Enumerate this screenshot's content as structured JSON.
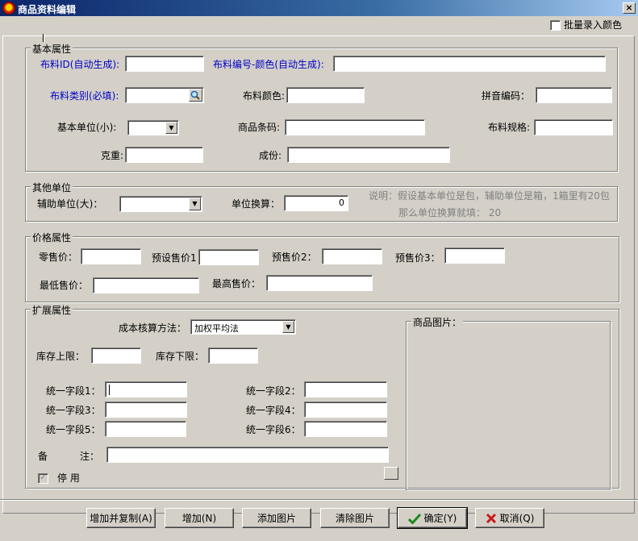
{
  "window": {
    "title": "商品资料编辑",
    "close_label": "×"
  },
  "batch_color": {
    "label": "批量录入颜色"
  },
  "basic": {
    "legend": "基本属性",
    "fabric_id_label": "布料ID(自动生成):",
    "fabric_code_color_label": "布料编号-颜色(自动生成):",
    "fabric_category_label": "布料类别(必填):",
    "fabric_color_label": "布料颜色:",
    "pinyin_label": "拼音编码：",
    "base_unit_label": "基本单位(小):",
    "barcode_label": "商品条码:",
    "spec_label": "布料规格:",
    "weight_label": "克重:",
    "composition_label": "成份:"
  },
  "other_unit": {
    "legend": "其他单位",
    "aux_unit_label": "辅助单位(大)：",
    "conversion_label": "单位换算：",
    "conversion_value": "0",
    "note_line1": "说明：假设基本单位是包，辅助单位是箱，1箱里有20包",
    "note_line2": "那么单位换算就填： 20"
  },
  "price": {
    "legend": "价格属性",
    "retail_label": "零售价：",
    "preset_price1_label": "预设售价1",
    "preset_price2_label": "预售价2：",
    "preset_price3_label": "预售价3：",
    "min_price_label": "最低售价：",
    "max_price_label": "最高售价："
  },
  "extended": {
    "legend": "扩展属性",
    "cost_method_label": "成本核算方法：",
    "cost_method_value": "加权平均法",
    "stock_upper_label": "库存上限：",
    "stock_lower_label": "库存下限：",
    "field1_label": "统一字段1：",
    "field2_label": "统一字段2：",
    "field3_label": "统一字段3：",
    "field4_label": "统一字段4：",
    "field5_label": "统一字段5：",
    "field6_label": "统一字段6：",
    "remark_label_a": "备",
    "remark_label_b": "注：",
    "disabled_label": "停 用",
    "product_image_label": "商品图片："
  },
  "buttons": {
    "add_copy": "增加并复制(A)",
    "add": "增加(N)",
    "add_image": "添加图片",
    "clear_image": "清除图片",
    "ok": "确定(Y)",
    "cancel": "取消(Q)"
  },
  "colors": {
    "title_start": "#0a246a",
    "title_end": "#a6caf0",
    "face": "#d4d0c8",
    "required_label": "#0000c8",
    "ok_icon": "#1a8a1a",
    "cancel_icon": "#c81818"
  }
}
